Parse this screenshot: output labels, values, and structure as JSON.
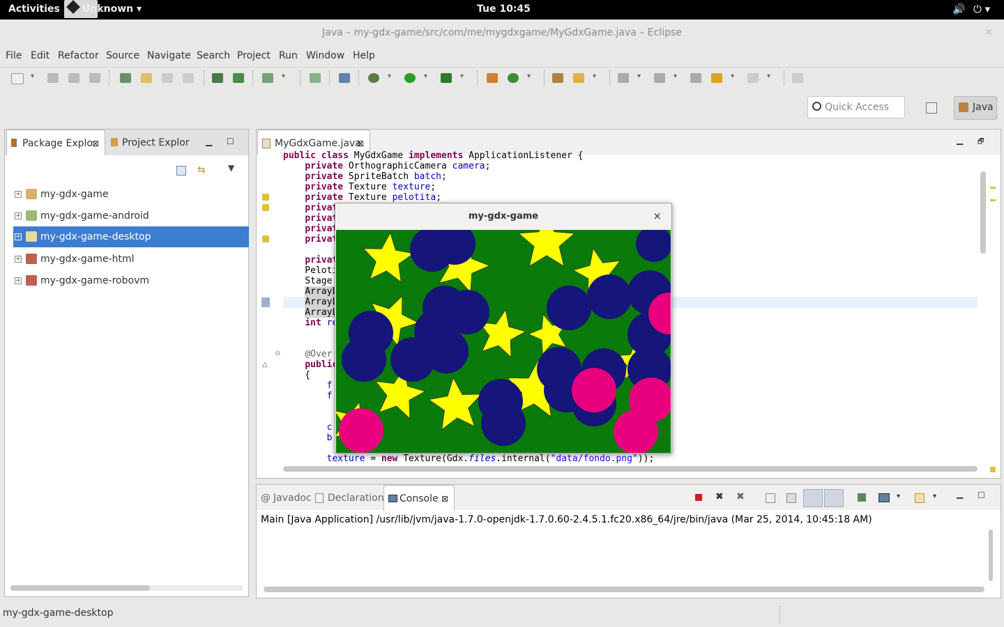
{
  "topbar": {
    "activities": "Activities",
    "app_name": "Unknown ▾",
    "clock": "Tue 10:45",
    "volume_icon": "🔊",
    "power_icon": "⏻ ▾"
  },
  "window": {
    "title": "Java – my-gdx-game/src/com/me/mygdxgame/MyGdxGame.java – Eclipse",
    "close": "×"
  },
  "menu": [
    "File",
    "Edit",
    "Refactor",
    "Source",
    "Navigate",
    "Search",
    "Project",
    "Run",
    "Window",
    "Help"
  ],
  "quick_access": {
    "placeholder": "Quick Access"
  },
  "perspective": {
    "label": "Java"
  },
  "left_panel": {
    "tabs": [
      {
        "label": "Package Explo",
        "close": "⊠"
      },
      {
        "label": "Project Explor"
      }
    ],
    "projects": [
      "my-gdx-game",
      "my-gdx-game-android",
      "my-gdx-game-desktop",
      "my-gdx-game-html",
      "my-gdx-game-robovm"
    ],
    "selected_index": 2
  },
  "editor": {
    "tab_label": "MyGdxGame.java",
    "tab_close": "⊠"
  },
  "game_window": {
    "title": "my-gdx-game",
    "close": "×"
  },
  "console": {
    "tabs": [
      {
        "label": "Javadoc"
      },
      {
        "label": "Declaration"
      },
      {
        "label": "Console"
      }
    ],
    "output": "Main [Java Application] /usr/lib/jvm/java-1.7.0-openjdk-1.7.0.60-2.4.5.1.fc20.x86_64/jre/bin/java (Mar 25, 2014, 10:45:18 AM)"
  },
  "status": {
    "text": "my-gdx-game-desktop"
  },
  "colors": {
    "game_green": "#0a7a0a",
    "star": "#ffff00",
    "blue_ball": "#15157a",
    "pink_ball": "#e8007e",
    "selection": "#3d7dd0"
  }
}
